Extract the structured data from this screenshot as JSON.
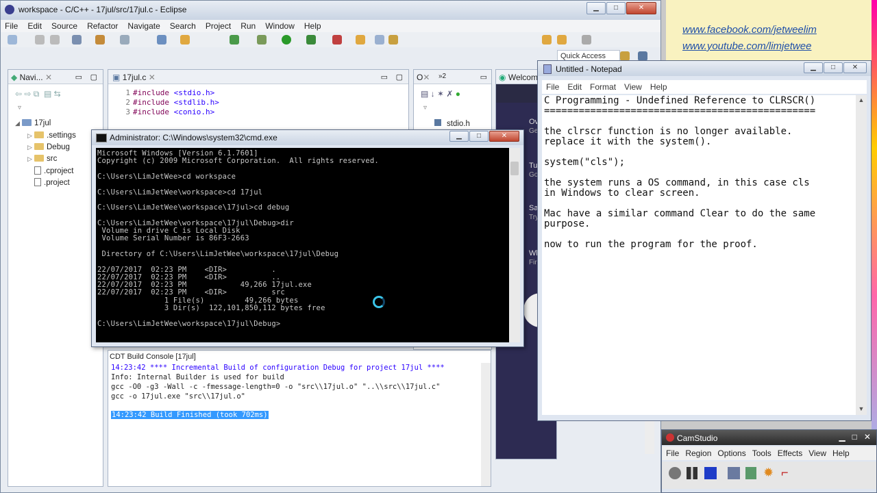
{
  "eclipse": {
    "title": "workspace - C/C++ - 17jul/src/17jul.c - Eclipse",
    "menu": [
      "File",
      "Edit",
      "Source",
      "Refactor",
      "Navigate",
      "Search",
      "Project",
      "Run",
      "Window",
      "Help"
    ],
    "quick_access": "Quick Access",
    "navigator": {
      "tab": "Navi...",
      "project": "17jul",
      "items": [
        ".settings",
        "Debug",
        "src",
        ".cproject",
        ".project"
      ]
    },
    "editor": {
      "tab": "17jul.c",
      "lines": [
        {
          "num": "1",
          "kw": "#include",
          "inc": "<stdio.h>"
        },
        {
          "num": "2",
          "kw": "#include",
          "inc": "<stdlib.h>"
        },
        {
          "num": "3",
          "kw": "#include",
          "inc": "<conio.h>"
        }
      ]
    },
    "outline": {
      "tab1": "O",
      "tab2": "»2",
      "item": "stdio.h"
    },
    "welcome": {
      "tab": "Welcom",
      "frags": [
        "Ov",
        "Ge",
        "Tu",
        "Go",
        "Sa",
        "Try",
        "Wh",
        "Fir"
      ]
    },
    "console": {
      "title": "CDT Build Console [17jul]",
      "lines": [
        "14:23:42 **** Incremental Build of configuration Debug for project 17jul ****",
        "Info: Internal Builder is used for build",
        "gcc -O0 -g3 -Wall -c -fmessage-length=0 -o \"src\\\\17jul.o\" \"..\\\\src\\\\17jul.c\"",
        "gcc -o 17jul.exe \"src\\\\17jul.o\""
      ],
      "finished": "14:23:42 Build Finished (took 702ms)"
    }
  },
  "cmd": {
    "title": "Administrator: C:\\Windows\\system32\\cmd.exe",
    "lines": [
      "Microsoft Windows [Version 6.1.7601]",
      "Copyright (c) 2009 Microsoft Corporation.  All rights reserved.",
      "",
      "C:\\Users\\LimJetWee>cd workspace",
      "",
      "C:\\Users\\LimJetWee\\workspace>cd 17jul",
      "",
      "C:\\Users\\LimJetWee\\workspace\\17jul>cd debug",
      "",
      "C:\\Users\\LimJetWee\\workspace\\17jul\\Debug>dir",
      " Volume in drive C is Local Disk",
      " Volume Serial Number is 86F3-2663",
      "",
      " Directory of C:\\Users\\LimJetWee\\workspace\\17jul\\Debug",
      "",
      "22/07/2017  02:23 PM    <DIR>          .",
      "22/07/2017  02:23 PM    <DIR>          ..",
      "22/07/2017  02:23 PM            49,266 17jul.exe",
      "22/07/2017  02:23 PM    <DIR>          src",
      "               1 File(s)         49,266 bytes",
      "               3 Dir(s)  122,101,850,112 bytes free",
      "",
      "C:\\Users\\LimJetWee\\workspace\\17jul\\Debug>"
    ]
  },
  "notepad": {
    "title": "Untitled - Notepad",
    "menu": [
      "File",
      "Edit",
      "Format",
      "View",
      "Help"
    ],
    "lines": [
      "C Programming - Undefined Reference to CLRSCR()",
      "===============================================",
      "",
      "the clrscr function is no longer available.",
      "replace it with the system().",
      "",
      "system(\"cls\");",
      "",
      "the system runs a OS command, in this case cls",
      "in Windows to clear screen.",
      "",
      "Mac have a similar command Clear to do the same",
      "purpose.",
      "",
      "now to run the program for the proof."
    ]
  },
  "camstudio": {
    "title": "CamStudio",
    "menu": [
      "File",
      "Region",
      "Options",
      "Tools",
      "Effects",
      "View",
      "Help"
    ]
  },
  "links": {
    "facebook": "www.facebook.com/jetweelim",
    "youtube": "www.youtube.com/limjetwee"
  }
}
